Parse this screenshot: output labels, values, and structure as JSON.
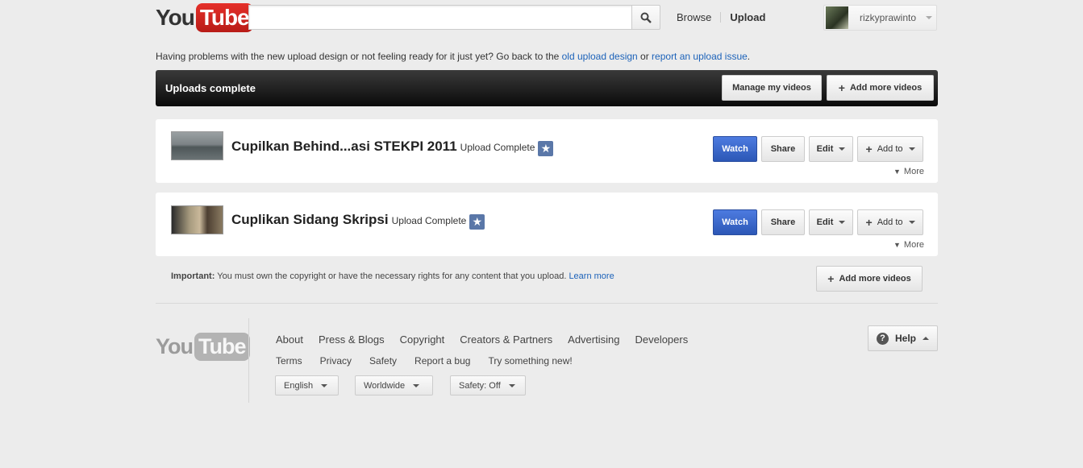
{
  "header": {
    "logo_you": "You",
    "logo_tube": "Tube",
    "search_placeholder": "",
    "nav_browse": "Browse",
    "nav_upload": "Upload",
    "username": "rizkyprawinto"
  },
  "notice": {
    "text_before": "Having problems with the new upload design or not feeling ready for it just yet? Go back to the ",
    "link_old": "old upload design",
    "text_middle": " or ",
    "link_report": "report an upload issue",
    "text_after": "."
  },
  "banner": {
    "title": "Uploads complete",
    "manage_label": "Manage my videos",
    "add_more_label": "Add more videos"
  },
  "videos": [
    {
      "title": "Cupilkan Behind...asi STEKPI 2011",
      "status": "Upload Complete",
      "watch": "Watch",
      "share": "Share",
      "edit": "Edit",
      "add_to": "Add to",
      "more": "More"
    },
    {
      "title": "Cuplikan Sidang Skripsi",
      "status": "Upload Complete",
      "watch": "Watch",
      "share": "Share",
      "edit": "Edit",
      "add_to": "Add to",
      "more": "More"
    }
  ],
  "important": {
    "label": "Important:",
    "text": " You must own the copyright or have the necessary rights for any content that you upload. ",
    "learn_more": "Learn more",
    "add_more_label": "Add more videos"
  },
  "footer": {
    "links_primary": [
      "About",
      "Press & Blogs",
      "Copyright",
      "Creators & Partners",
      "Advertising",
      "Developers"
    ],
    "links_secondary": [
      "Terms",
      "Privacy",
      "Safety",
      "Report a bug",
      "Try something new!"
    ],
    "language": "English",
    "location": "Worldwide",
    "safety": "Safety: Off",
    "help": "Help"
  },
  "colors": {
    "brand_red": "#e5302a",
    "watch_blue": "#2c57b6",
    "link_blue": "#1c62b9"
  },
  "icons": {
    "search": "search-icon",
    "star": "star-icon",
    "help": "help-icon"
  }
}
